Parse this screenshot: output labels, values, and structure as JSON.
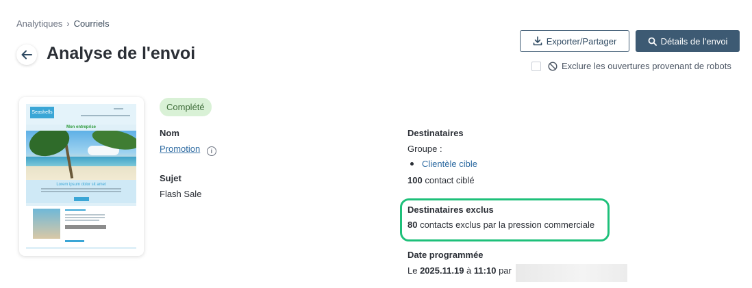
{
  "breadcrumb": {
    "root": "Analytiques",
    "separator": "›",
    "current": "Courriels"
  },
  "page": {
    "title": "Analyse de l'envoi",
    "back_icon": "arrow-left-icon"
  },
  "actions": {
    "export_label": "Exporter/Partager",
    "export_icon": "download-icon",
    "details_label": "Détails de l'envoi",
    "details_icon": "search-icon",
    "accent": "#3d5a73"
  },
  "robots": {
    "label": "Exclure les ouvertures provenant de robots",
    "checked": false,
    "icon": "block-icon"
  },
  "preview": {
    "logo": "Seashells",
    "brand": "Mon entreprise",
    "promo_title": "Lorem ipsum dolor sit amet",
    "article_title": "Lorem ipsum"
  },
  "status": {
    "label": "Complété",
    "color": "#d9f1d6"
  },
  "info": {
    "name_label": "Nom",
    "name_value": "Promotion",
    "subject_label": "Sujet",
    "subject_value": "Flash Sale",
    "recipients_label": "Destinataires",
    "group_label": "Groupe :",
    "group_item": "Clientèle cible",
    "targeted_count": "100",
    "targeted_text": " contact ciblé",
    "excluded_label": "Destinataires exclus",
    "excluded_count": "80",
    "excluded_text": " contacts exclus par la pression commerciale",
    "scheduled_label": "Date programmée",
    "scheduled_prefix": "Le ",
    "scheduled_date": "2025.11.19",
    "scheduled_mid": " à ",
    "scheduled_time": "11:10",
    "scheduled_suffix": " par",
    "highlight_color": "#1ec07a"
  }
}
